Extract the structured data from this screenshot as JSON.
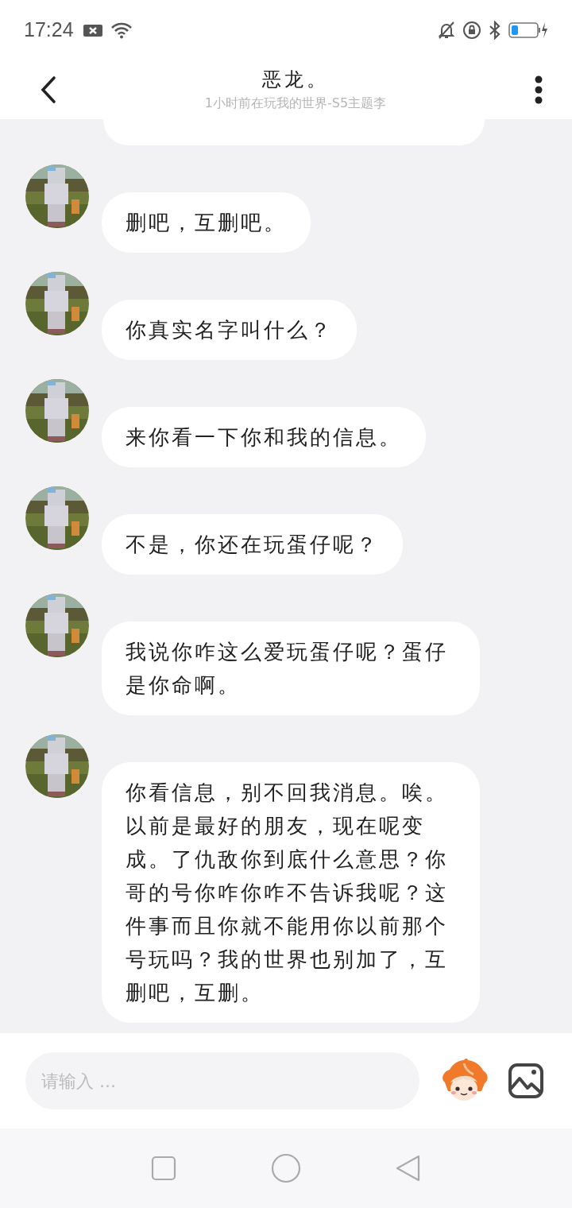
{
  "status_bar": {
    "time": "17:24"
  },
  "header": {
    "title": "恶龙。",
    "subtitle": "1小时前在玩我的世界-S5主题李"
  },
  "messages": [
    {
      "kind": "cut"
    },
    {
      "kind": "text",
      "text": "删吧，互删吧。"
    },
    {
      "kind": "text",
      "text": "你真实名字叫什么？"
    },
    {
      "kind": "text",
      "text": "来你看一下你和我的信息。"
    },
    {
      "kind": "text",
      "text": "不是，你还在玩蛋仔呢？"
    },
    {
      "kind": "text",
      "text": "我说你咋这么爱玩蛋仔呢？蛋仔是你命啊。"
    },
    {
      "kind": "text",
      "text": "你看信息，别不回我消息。唉。以前是最好的朋友，现在呢变成。了仇敌你到底什么意思？你哥的号你咋你咋不告诉我呢？这件事而且你就不能用你以前那个号玩吗？我的世界也别加了，互删吧，互删。"
    }
  ],
  "input": {
    "placeholder": "请输入 ..."
  }
}
